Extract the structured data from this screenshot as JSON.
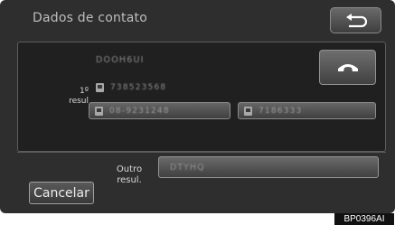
{
  "window": {
    "title": "Dados de contato",
    "back_icon": "back-arrow-icon"
  },
  "result": {
    "label_line1": "1º",
    "label_line2": "resul",
    "name": "DOOH6UI",
    "numbers": [
      {
        "icon": "mobile-phone-icon",
        "value": "738523568"
      },
      {
        "icon": "home-phone-icon",
        "value": "08-9231248"
      },
      {
        "icon": "work-phone-icon",
        "value": "7186333"
      }
    ],
    "call_icon": "phone-handset-icon"
  },
  "other": {
    "label_line1": "Outro",
    "label_line2": "resul.",
    "value": "DTYHQ"
  },
  "cancel_label": "Cancelar",
  "reference_code": "BP0396AI"
}
